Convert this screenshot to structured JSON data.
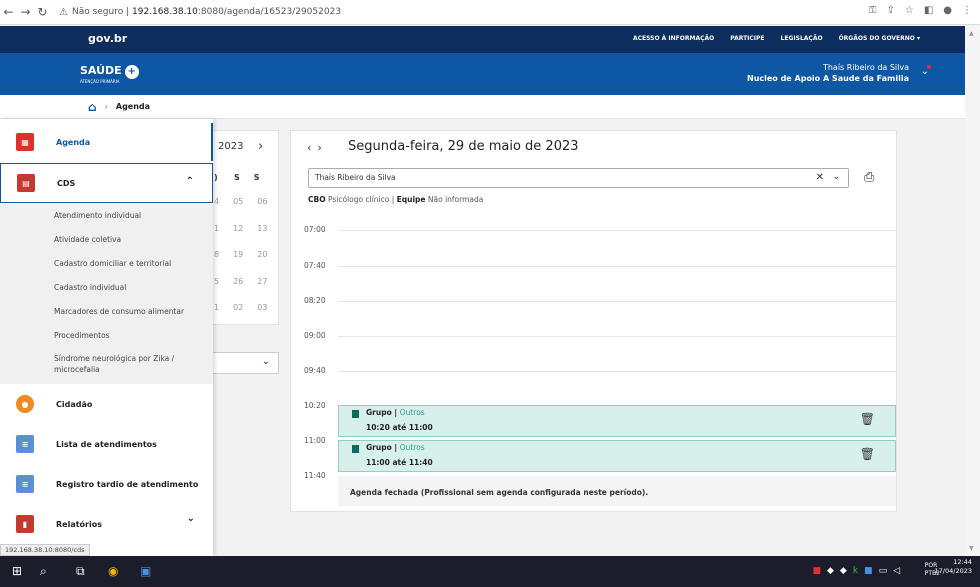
{
  "browser": {
    "security_label": "Não seguro",
    "url_host": "192.168.38.10",
    "url_path": ":8080/agenda/16523/29052023"
  },
  "govbar": {
    "logo": "gov.br",
    "links": [
      "ACESSO À INFORMAÇÃO",
      "PARTICIPE",
      "LEGISLAÇÃO",
      "ÓRGÃOS DO GOVERNO"
    ]
  },
  "header": {
    "brand": "SAÚDE",
    "brand_sub": "ATENÇÃO PRIMÁRIA",
    "user_name": "Thaís Ribeiro da Silva",
    "user_unit": "Nucleo de Apoio A Saude da Familia"
  },
  "breadcrumb": {
    "current": "Agenda"
  },
  "minical": {
    "year": "2023",
    "header_days": [
      "S",
      "S"
    ],
    "rows": [
      [
        "05",
        "06"
      ],
      [
        "12",
        "13"
      ],
      [
        "19",
        "20"
      ],
      [
        "26",
        "27"
      ],
      [
        "02",
        "03"
      ]
    ],
    "row_prefix": [
      "4",
      "1",
      "8",
      "5",
      "1"
    ]
  },
  "sidebar": {
    "agenda": "Agenda",
    "cds": "CDS",
    "cds_items": [
      "Atendimento individual",
      "Atividade coletiva",
      "Cadastro domiciliar e territorial",
      "Cadastro individual",
      "Marcadores de consumo alimentar",
      "Procedimentos",
      "Síndrome neurológica por Zika / microcefalia"
    ],
    "cidadao": "Cidadão",
    "lista": "Lista de atendimentos",
    "registro": "Registro tardio de atendimento",
    "relatorios": "Relatórios"
  },
  "status_url": "192.168.38.10:8080/cds",
  "main": {
    "date_title": "Segunda-feira, 29 de maio de 2023",
    "professional": "Thaís Ribeiro da Silva",
    "cbo_label": "CBO",
    "cbo_value": "Psicólogo clínico",
    "equipe_label": "Equipe",
    "equipe_value": "Não informada",
    "times": [
      "07:00",
      "07:40",
      "08:20",
      "09:00",
      "09:40",
      "10:20",
      "11:00",
      "11:40"
    ],
    "events": [
      {
        "title": "Grupo",
        "category": "Outros",
        "time": "10:20 até 11:00"
      },
      {
        "title": "Grupo",
        "category": "Outros",
        "time": "11:00 até 11:40"
      }
    ],
    "closed_message": "Agenda fechada (Profissional sem agenda configurada neste período)."
  },
  "taskbar": {
    "lang1": "POR",
    "lang2": "PTB2",
    "time": "12:44",
    "date": "17/04/2023"
  },
  "colors": {
    "gov_dark": "#0c2d5d",
    "brand_blue": "#0e57a5",
    "event_bg": "#d7f0ec",
    "event_accent": "#0b6a5b"
  }
}
